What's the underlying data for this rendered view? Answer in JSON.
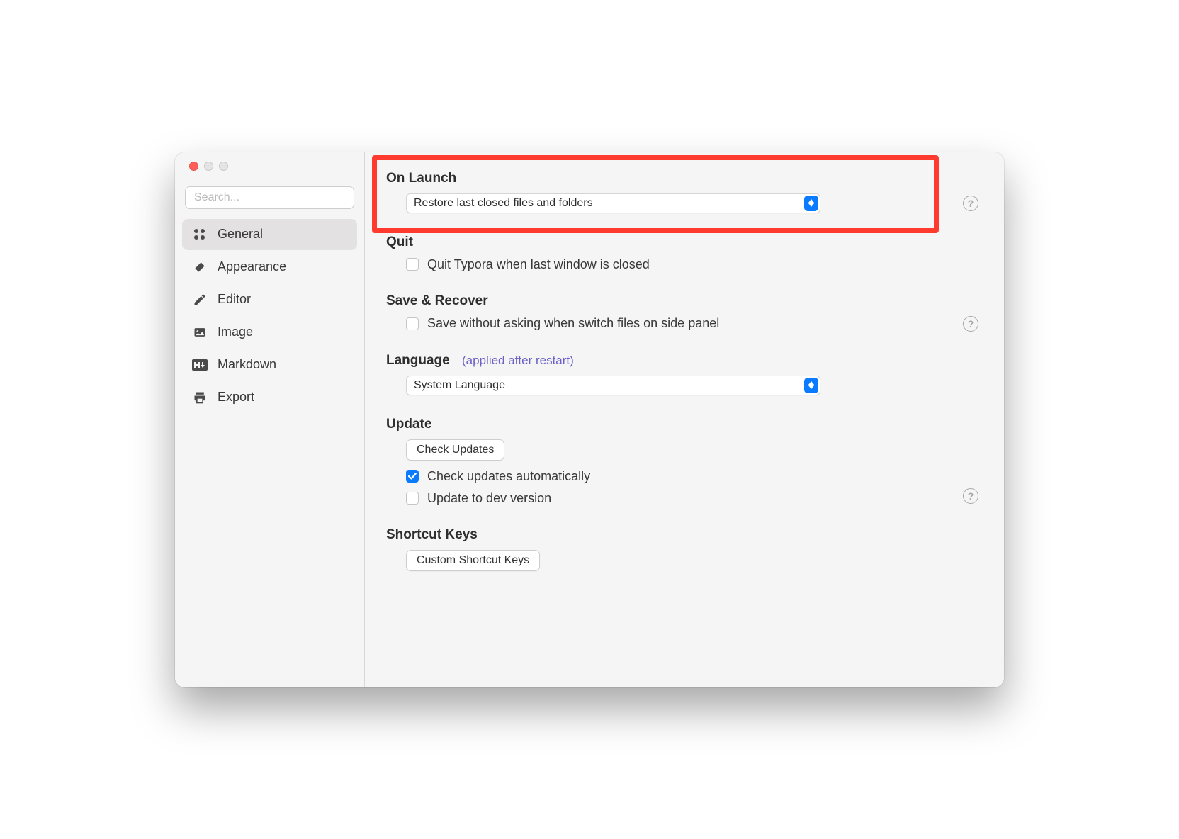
{
  "search": {
    "placeholder": "Search..."
  },
  "sidebar": {
    "items": [
      {
        "label": "General",
        "icon": "grid-icon",
        "active": true
      },
      {
        "label": "Appearance",
        "icon": "paint-icon",
        "active": false
      },
      {
        "label": "Editor",
        "icon": "pencil-icon",
        "active": false
      },
      {
        "label": "Image",
        "icon": "image-icon",
        "active": false
      },
      {
        "label": "Markdown",
        "icon": "markdown-icon",
        "active": false
      },
      {
        "label": "Export",
        "icon": "export-icon",
        "active": false
      }
    ]
  },
  "sections": {
    "onLaunch": {
      "title": "On Launch",
      "select_value": "Restore last closed files and folders"
    },
    "quit": {
      "title": "Quit",
      "option_label": "Quit Typora when last window is closed",
      "option_checked": false
    },
    "saveRecover": {
      "title": "Save & Recover",
      "option_label": "Save without asking when switch files on side panel",
      "option_checked": false
    },
    "language": {
      "title": "Language",
      "note": "(applied after restart)",
      "select_value": "System Language"
    },
    "update": {
      "title": "Update",
      "check_button": "Check Updates",
      "auto_label": "Check updates automatically",
      "auto_checked": true,
      "dev_label": "Update to dev version",
      "dev_checked": false
    },
    "shortcut": {
      "title": "Shortcut Keys",
      "button": "Custom Shortcut Keys"
    }
  }
}
